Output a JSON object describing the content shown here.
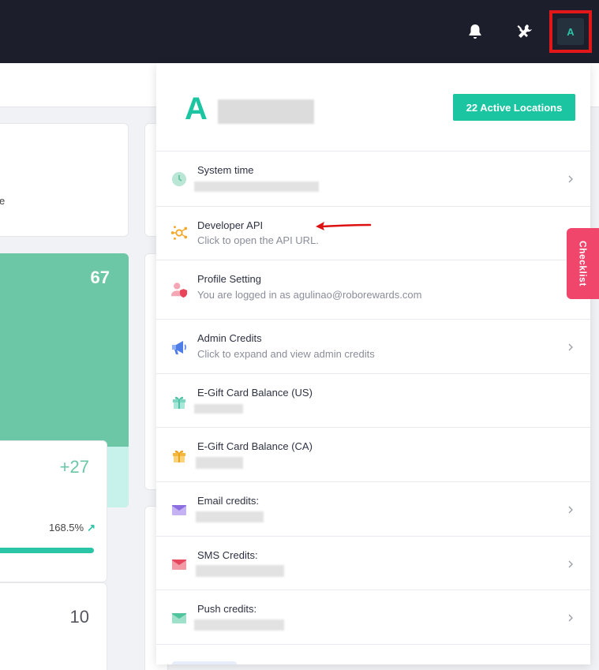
{
  "topbar": {
    "avatar_initial": "A"
  },
  "background": {
    "card1_text": "e",
    "green_number": "67",
    "card2_number": "+27",
    "card2_percent": "168.5%",
    "card2_trend_icon": "arrow-up-right",
    "card3_number": "10"
  },
  "panel": {
    "initial": "A",
    "locations_button": "22 Active Locations",
    "rows": [
      {
        "title": "System time",
        "subtitle": "",
        "icon": "clock-icon"
      },
      {
        "title": "Developer API",
        "subtitle": "Click to open the API URL.",
        "icon": "api-icon"
      },
      {
        "title": "Profile Setting",
        "subtitle": "You are logged in as agulinao@roborewards.com",
        "icon": "user-shield-icon"
      },
      {
        "title": "Admin Credits",
        "subtitle": "Click to expand and view admin credits",
        "icon": "megaphone-icon"
      },
      {
        "title": "E-Gift Card Balance (US)",
        "subtitle": "",
        "icon": "gift-icon"
      },
      {
        "title": "E-Gift Card Balance (CA)",
        "subtitle": "",
        "icon": "gift-icon"
      },
      {
        "title": "Email credits:",
        "subtitle": "",
        "icon": "email-icon"
      },
      {
        "title": "SMS Credits:",
        "subtitle": "",
        "icon": "sms-icon"
      },
      {
        "title": "Push credits:",
        "subtitle": "",
        "icon": "push-icon"
      }
    ]
  },
  "checklist_tab": "Checklist",
  "colors": {
    "accent": "#1cc5a2",
    "topbar": "#1d1e2c",
    "highlight_box": "#e31717",
    "checklist": "#f0466c"
  }
}
